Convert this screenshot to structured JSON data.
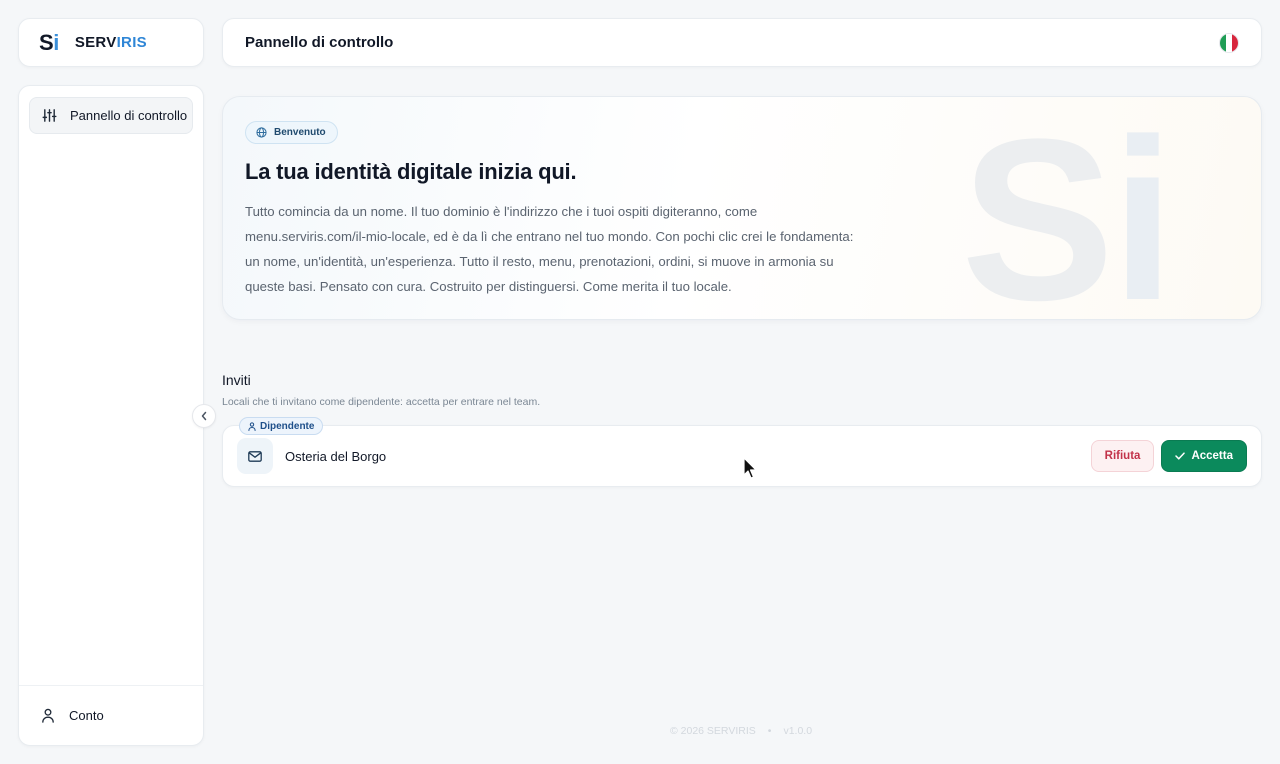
{
  "brand": {
    "mark_s": "S",
    "mark_i": "i",
    "name_dark": "SERV",
    "name_blue": "IRIS",
    "colors": {
      "dark": "#111827",
      "blue": "#2f86d6"
    }
  },
  "header": {
    "title": "Pannello di controllo",
    "language_flag": "italy-flag-icon"
  },
  "sidebar": {
    "items": [
      {
        "label": "Pannello di controllo",
        "icon": "sliders-icon",
        "active": true
      }
    ],
    "bottom": {
      "label": "Conto",
      "icon": "user-icon"
    }
  },
  "hero": {
    "badge": "Benvenuto",
    "badge_icon": "globe-icon",
    "title": "La tua identità digitale inizia qui.",
    "text": "Tutto comincia da un nome. Il tuo dominio è l'indirizzo che i tuoi ospiti digiteranno, come menu.serviris.com/il-mio-locale, ed è da lì che entrano nel tuo mondo. Con pochi clic crei le fondamenta: un nome, un'identità, un'esperienza. Tutto il resto, menu, prenotazioni, ordini, si muove in armonia su queste basi. Pensato con cura. Costruito per distinguersi. Come merita il tuo locale.",
    "watermark_s": "S",
    "watermark_i": "i"
  },
  "invites": {
    "title": "Inviti",
    "subtitle": "Locali che ti invitano come dipendente: accetta per entrare nel team.",
    "items": [
      {
        "tag": "Dipendente",
        "name": "Osteria del Borgo",
        "icon": "mail-icon",
        "reject_label": "Rifiuta",
        "accept_label": "Accetta"
      }
    ]
  },
  "footer": {
    "copyright": "© 2026 SERVIRIS",
    "separator": "•",
    "version": "v1.0.0"
  },
  "colors": {
    "accept": "#0b8a5c",
    "reject_text": "#c2334a",
    "accent": "#2f86d6"
  }
}
